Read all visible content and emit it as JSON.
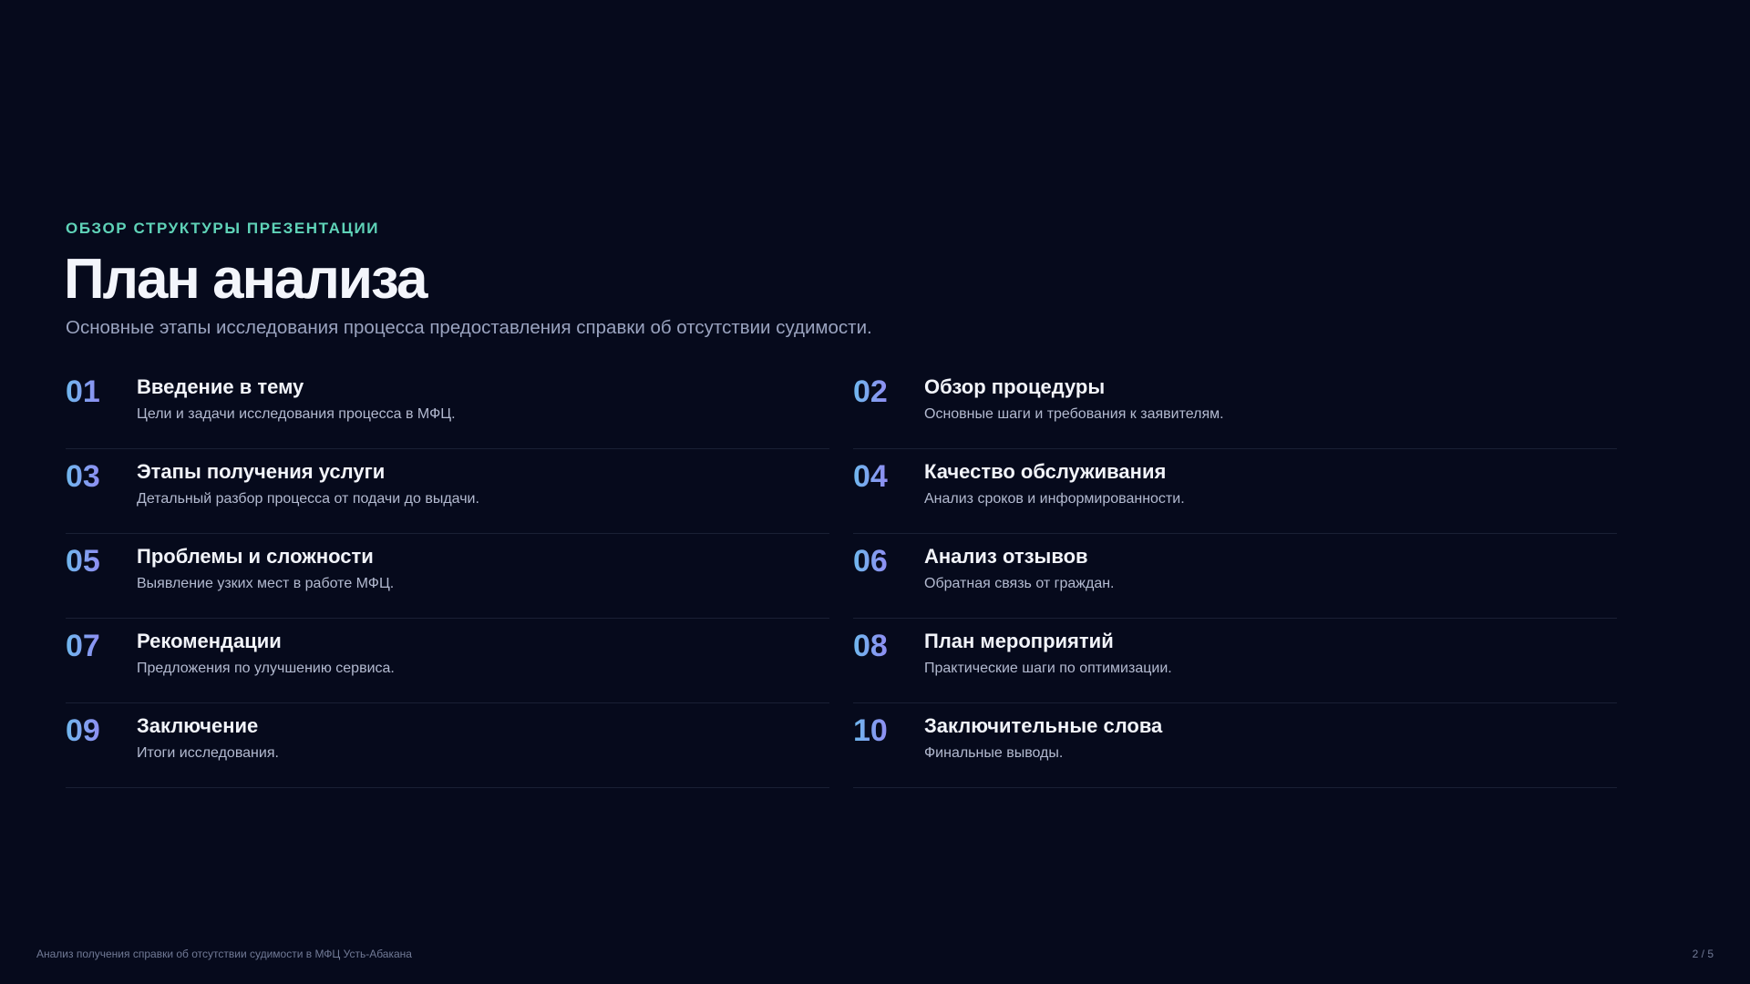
{
  "eyebrow": "ОБЗОР СТРУКТУРЫ ПРЕЗЕНТАЦИИ",
  "title": "План анализа",
  "subtitle": "Основные этапы исследования процесса предоставления справки об отсутствии судимости.",
  "items": [
    {
      "num": "01",
      "title": "Введение в тему",
      "desc": "Цели и задачи исследования процесса в МФЦ."
    },
    {
      "num": "02",
      "title": "Обзор процедуры",
      "desc": "Основные шаги и требования к заявителям."
    },
    {
      "num": "03",
      "title": "Этапы получения услуги",
      "desc": "Детальный разбор процесса от подачи до выдачи."
    },
    {
      "num": "04",
      "title": "Качество обслуживания",
      "desc": "Анализ сроков и информированности."
    },
    {
      "num": "05",
      "title": "Проблемы и сложности",
      "desc": "Выявление узких мест в работе МФЦ."
    },
    {
      "num": "06",
      "title": "Анализ отзывов",
      "desc": "Обратная связь от граждан."
    },
    {
      "num": "07",
      "title": "Рекомендации",
      "desc": "Предложения по улучшению сервиса."
    },
    {
      "num": "08",
      "title": "План мероприятий",
      "desc": "Практические шаги по оптимизации."
    },
    {
      "num": "09",
      "title": "Заключение",
      "desc": "Итоги исследования."
    },
    {
      "num": "10",
      "title": "Заключительные слова",
      "desc": "Финальные выводы."
    }
  ],
  "footer": {
    "left": "Анализ получения справки об отсутствии судимости в МФЦ Усть-Абакана",
    "page": "2 / 5"
  },
  "colors": {
    "background": "#060a1c",
    "accent": "#5fd3b8",
    "number_gradient_start": "#6fb8ee",
    "number_gradient_end": "#8f8df2"
  }
}
